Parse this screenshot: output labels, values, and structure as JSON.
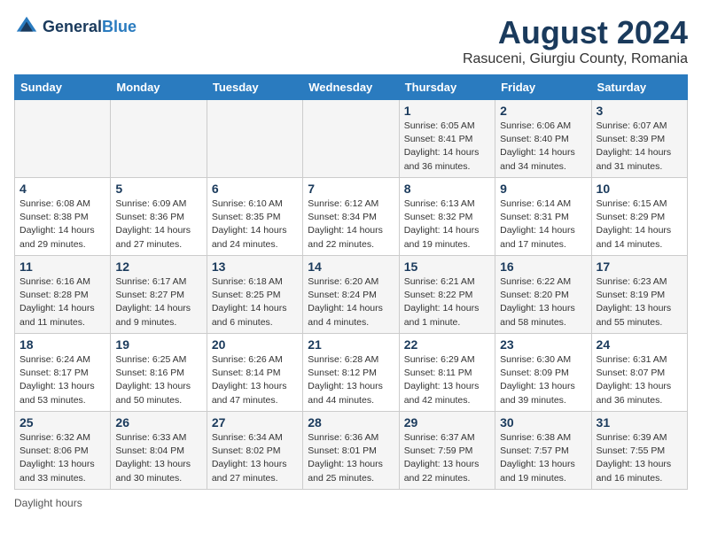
{
  "header": {
    "logo_general": "General",
    "logo_blue": "Blue",
    "month_title": "August 2024",
    "location": "Rasuceni, Giurgiu County, Romania"
  },
  "weekdays": [
    "Sunday",
    "Monday",
    "Tuesday",
    "Wednesday",
    "Thursday",
    "Friday",
    "Saturday"
  ],
  "footer": {
    "daylight_note": "Daylight hours"
  },
  "weeks": [
    [
      {
        "day": "",
        "info": ""
      },
      {
        "day": "",
        "info": ""
      },
      {
        "day": "",
        "info": ""
      },
      {
        "day": "",
        "info": ""
      },
      {
        "day": "1",
        "info": "Sunrise: 6:05 AM\nSunset: 8:41 PM\nDaylight: 14 hours\nand 36 minutes."
      },
      {
        "day": "2",
        "info": "Sunrise: 6:06 AM\nSunset: 8:40 PM\nDaylight: 14 hours\nand 34 minutes."
      },
      {
        "day": "3",
        "info": "Sunrise: 6:07 AM\nSunset: 8:39 PM\nDaylight: 14 hours\nand 31 minutes."
      }
    ],
    [
      {
        "day": "4",
        "info": "Sunrise: 6:08 AM\nSunset: 8:38 PM\nDaylight: 14 hours\nand 29 minutes."
      },
      {
        "day": "5",
        "info": "Sunrise: 6:09 AM\nSunset: 8:36 PM\nDaylight: 14 hours\nand 27 minutes."
      },
      {
        "day": "6",
        "info": "Sunrise: 6:10 AM\nSunset: 8:35 PM\nDaylight: 14 hours\nand 24 minutes."
      },
      {
        "day": "7",
        "info": "Sunrise: 6:12 AM\nSunset: 8:34 PM\nDaylight: 14 hours\nand 22 minutes."
      },
      {
        "day": "8",
        "info": "Sunrise: 6:13 AM\nSunset: 8:32 PM\nDaylight: 14 hours\nand 19 minutes."
      },
      {
        "day": "9",
        "info": "Sunrise: 6:14 AM\nSunset: 8:31 PM\nDaylight: 14 hours\nand 17 minutes."
      },
      {
        "day": "10",
        "info": "Sunrise: 6:15 AM\nSunset: 8:29 PM\nDaylight: 14 hours\nand 14 minutes."
      }
    ],
    [
      {
        "day": "11",
        "info": "Sunrise: 6:16 AM\nSunset: 8:28 PM\nDaylight: 14 hours\nand 11 minutes."
      },
      {
        "day": "12",
        "info": "Sunrise: 6:17 AM\nSunset: 8:27 PM\nDaylight: 14 hours\nand 9 minutes."
      },
      {
        "day": "13",
        "info": "Sunrise: 6:18 AM\nSunset: 8:25 PM\nDaylight: 14 hours\nand 6 minutes."
      },
      {
        "day": "14",
        "info": "Sunrise: 6:20 AM\nSunset: 8:24 PM\nDaylight: 14 hours\nand 4 minutes."
      },
      {
        "day": "15",
        "info": "Sunrise: 6:21 AM\nSunset: 8:22 PM\nDaylight: 14 hours\nand 1 minute."
      },
      {
        "day": "16",
        "info": "Sunrise: 6:22 AM\nSunset: 8:20 PM\nDaylight: 13 hours\nand 58 minutes."
      },
      {
        "day": "17",
        "info": "Sunrise: 6:23 AM\nSunset: 8:19 PM\nDaylight: 13 hours\nand 55 minutes."
      }
    ],
    [
      {
        "day": "18",
        "info": "Sunrise: 6:24 AM\nSunset: 8:17 PM\nDaylight: 13 hours\nand 53 minutes."
      },
      {
        "day": "19",
        "info": "Sunrise: 6:25 AM\nSunset: 8:16 PM\nDaylight: 13 hours\nand 50 minutes."
      },
      {
        "day": "20",
        "info": "Sunrise: 6:26 AM\nSunset: 8:14 PM\nDaylight: 13 hours\nand 47 minutes."
      },
      {
        "day": "21",
        "info": "Sunrise: 6:28 AM\nSunset: 8:12 PM\nDaylight: 13 hours\nand 44 minutes."
      },
      {
        "day": "22",
        "info": "Sunrise: 6:29 AM\nSunset: 8:11 PM\nDaylight: 13 hours\nand 42 minutes."
      },
      {
        "day": "23",
        "info": "Sunrise: 6:30 AM\nSunset: 8:09 PM\nDaylight: 13 hours\nand 39 minutes."
      },
      {
        "day": "24",
        "info": "Sunrise: 6:31 AM\nSunset: 8:07 PM\nDaylight: 13 hours\nand 36 minutes."
      }
    ],
    [
      {
        "day": "25",
        "info": "Sunrise: 6:32 AM\nSunset: 8:06 PM\nDaylight: 13 hours\nand 33 minutes."
      },
      {
        "day": "26",
        "info": "Sunrise: 6:33 AM\nSunset: 8:04 PM\nDaylight: 13 hours\nand 30 minutes."
      },
      {
        "day": "27",
        "info": "Sunrise: 6:34 AM\nSunset: 8:02 PM\nDaylight: 13 hours\nand 27 minutes."
      },
      {
        "day": "28",
        "info": "Sunrise: 6:36 AM\nSunset: 8:01 PM\nDaylight: 13 hours\nand 25 minutes."
      },
      {
        "day": "29",
        "info": "Sunrise: 6:37 AM\nSunset: 7:59 PM\nDaylight: 13 hours\nand 22 minutes."
      },
      {
        "day": "30",
        "info": "Sunrise: 6:38 AM\nSunset: 7:57 PM\nDaylight: 13 hours\nand 19 minutes."
      },
      {
        "day": "31",
        "info": "Sunrise: 6:39 AM\nSunset: 7:55 PM\nDaylight: 13 hours\nand 16 minutes."
      }
    ]
  ]
}
